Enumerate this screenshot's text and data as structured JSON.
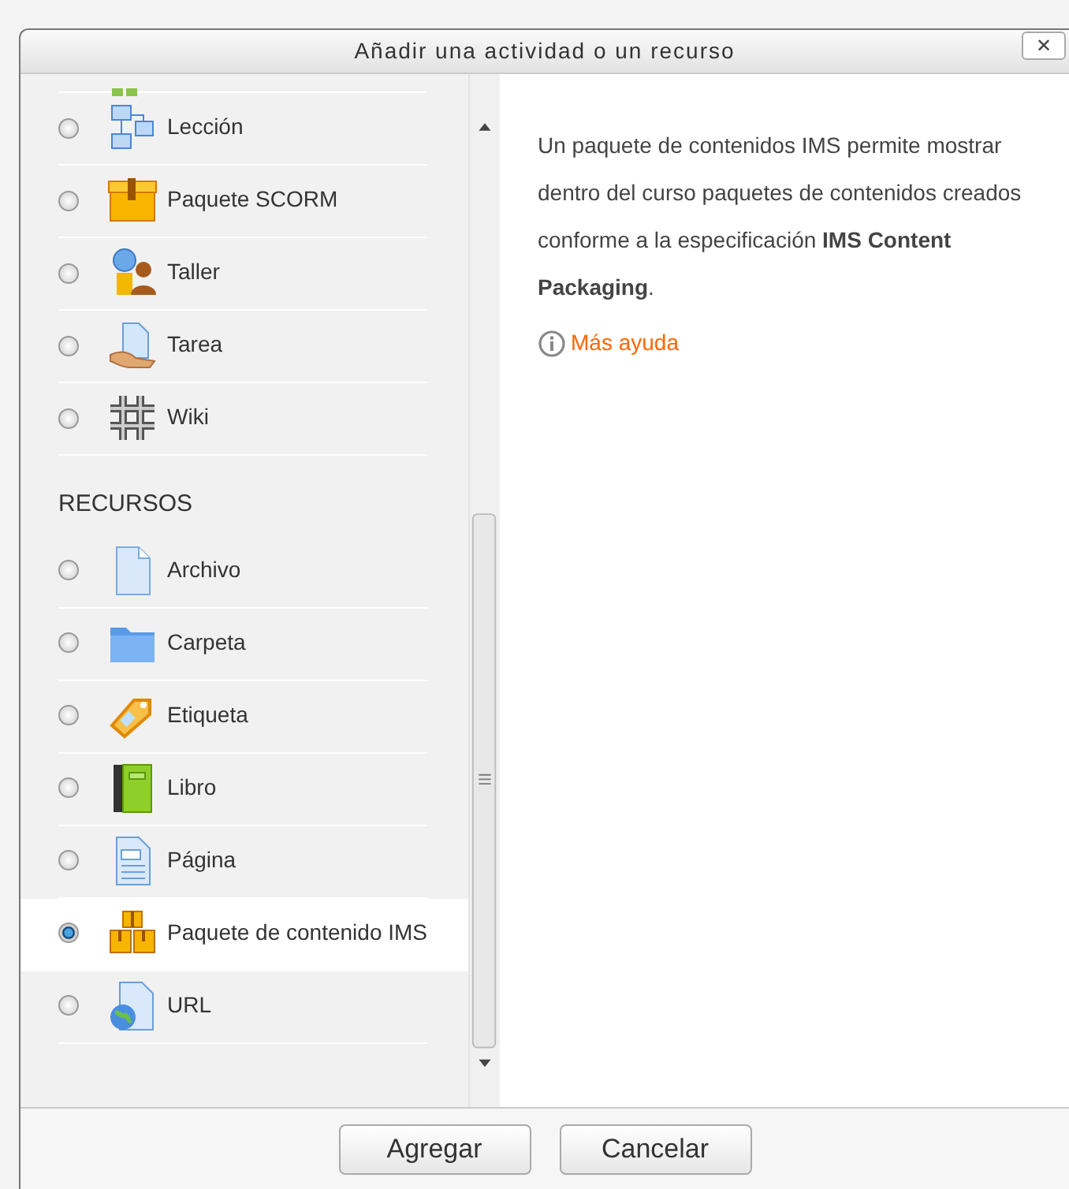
{
  "dialog": {
    "title": "Añadir una actividad o un recurso",
    "close": "✕"
  },
  "items": [
    {
      "kind": "option",
      "label": "Lección",
      "selected": false
    },
    {
      "kind": "option",
      "label": "Paquete SCORM",
      "selected": false
    },
    {
      "kind": "option",
      "label": "Taller",
      "selected": false
    },
    {
      "kind": "option",
      "label": "Tarea",
      "selected": false
    },
    {
      "kind": "option",
      "label": "Wiki",
      "selected": false
    },
    {
      "kind": "section",
      "label": "RECURSOS"
    },
    {
      "kind": "option",
      "label": "Archivo",
      "selected": false
    },
    {
      "kind": "option",
      "label": "Carpeta",
      "selected": false
    },
    {
      "kind": "option",
      "label": "Etiqueta",
      "selected": false
    },
    {
      "kind": "option",
      "label": "Libro",
      "selected": false
    },
    {
      "kind": "option",
      "label": "Página",
      "selected": false
    },
    {
      "kind": "option",
      "label": "Paquete de contenido IMS",
      "selected": true
    },
    {
      "kind": "option",
      "label": "URL",
      "selected": false
    }
  ],
  "description": "Un paquete de contenidos IMS permite mostrar dentro del curso paquetes de contenidos creados conforme a la especificación **IMS Content Packaging**.",
  "help_link": "Más ayuda",
  "buttons": [
    "Agregar",
    "Cancelar"
  ]
}
